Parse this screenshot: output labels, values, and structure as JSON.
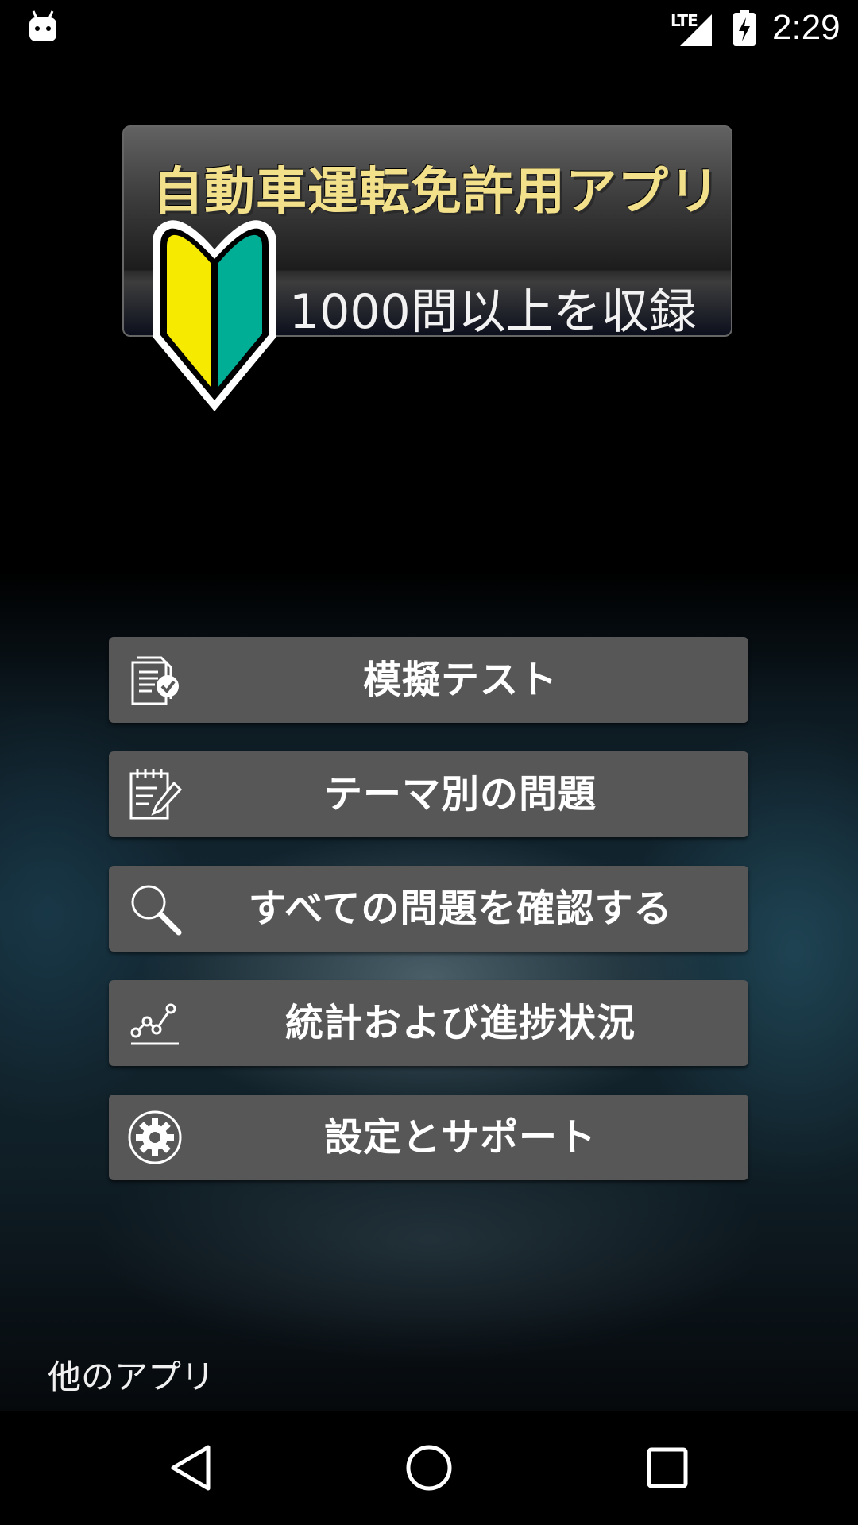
{
  "status_bar": {
    "network": "LTE",
    "time": "2:29",
    "left_icon": "android-debug-icon",
    "signal_icon": "signal-icon",
    "battery_icon": "battery-charging-icon"
  },
  "banner": {
    "title": "自動車運転免許用アプリ",
    "subtitle": "1000問以上を収録",
    "mark_icon": "beginner-driver-mark-icon",
    "colors": {
      "title": "#f2e08a",
      "mark_yellow": "#f6ea00",
      "mark_green": "#00ae95"
    }
  },
  "menu": {
    "items": [
      {
        "label": "模擬テスト",
        "icon": "checked-document-icon"
      },
      {
        "label": "テーマ別の問題",
        "icon": "notepad-pencil-icon"
      },
      {
        "label": "すべての問題を確認する",
        "icon": "magnifier-icon"
      },
      {
        "label": "統計および進捗状況",
        "icon": "line-chart-icon"
      },
      {
        "label": "設定とサポート",
        "icon": "gear-icon"
      }
    ],
    "button_color": "#575757"
  },
  "footer": {
    "other_apps": "他のアプリ"
  },
  "nav_bar": {
    "back_icon": "back-triangle-icon",
    "home_icon": "home-circle-icon",
    "recents_icon": "recents-square-icon"
  }
}
